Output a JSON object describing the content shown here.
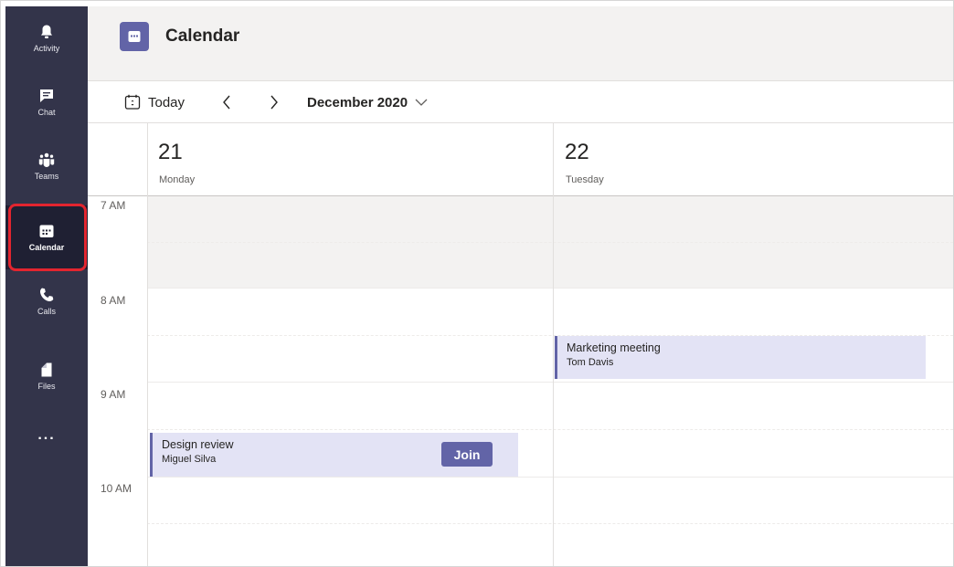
{
  "app": {
    "title": "Calendar",
    "accent_color": "#6264a7",
    "rail_color": "#33344a"
  },
  "rail": {
    "items": [
      {
        "label": "Activity",
        "icon": "bell-icon"
      },
      {
        "label": "Chat",
        "icon": "chat-icon"
      },
      {
        "label": "Teams",
        "icon": "teams-icon"
      },
      {
        "label": "Calendar",
        "icon": "calendar-icon",
        "active": true
      },
      {
        "label": "Calls",
        "icon": "phone-icon"
      },
      {
        "label": "Files",
        "icon": "file-icon"
      }
    ],
    "more": "..."
  },
  "toolbar": {
    "today_label": "Today",
    "prev_icon": "chevron-left-icon",
    "next_icon": "chevron-right-icon",
    "month_label": "December 2020",
    "month_chevron_icon": "chevron-down-icon"
  },
  "days": [
    {
      "number": "21",
      "name": "Monday"
    },
    {
      "number": "22",
      "name": "Tuesday"
    }
  ],
  "time_labels": [
    "7 AM",
    "8 AM",
    "9 AM",
    "10 AM"
  ],
  "events": [
    {
      "title": "Marketing meeting",
      "organizer": "Tom Davis",
      "day": "Tuesday",
      "start": "8:30 AM",
      "end": "9:00 AM",
      "has_join": false
    },
    {
      "title": "Design review",
      "organizer": "Miguel Silva",
      "day": "Monday",
      "start": "9:30 AM",
      "end": "10:00 AM",
      "has_join": true,
      "join_label": "Join"
    }
  ]
}
